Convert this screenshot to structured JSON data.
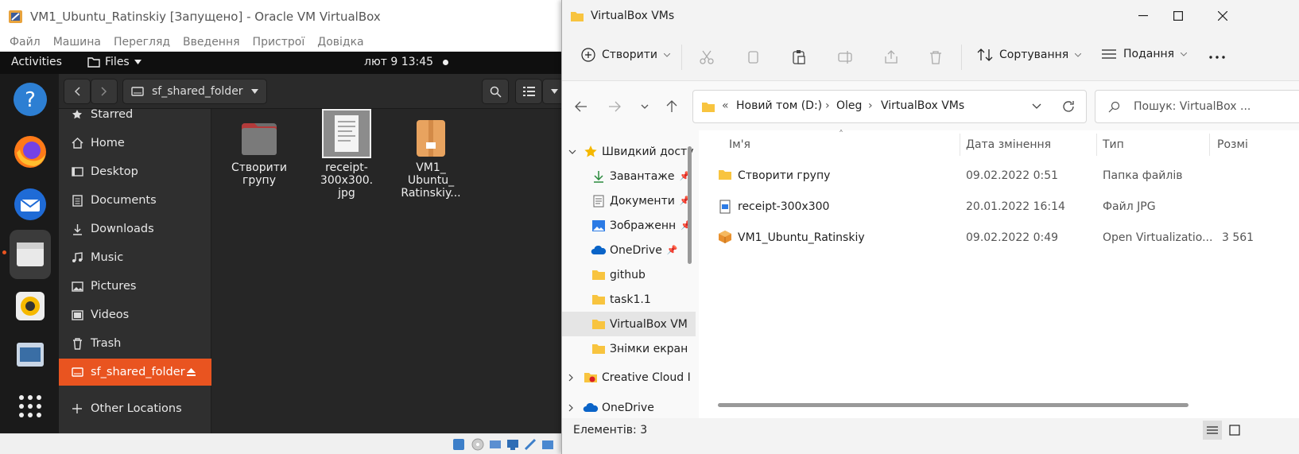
{
  "vbox": {
    "title": "VM1_Ubuntu_Ratinskiy [Запущено] - Oracle VM VirtualBox",
    "menu": [
      "Файл",
      "Машина",
      "Перегляд",
      "Введення",
      "Пристрої",
      "Довідка"
    ]
  },
  "ubuntu": {
    "activities": "Activities",
    "app_menu": "Files",
    "clock": "лют 9  13:45",
    "dock": [
      "help-icon",
      "firefox-icon",
      "thunderbird-icon",
      "files-icon",
      "rhythmbox-icon",
      "software-center-icon",
      "show-apps-icon"
    ],
    "path_label": "sf_shared_folder",
    "sidebar": [
      {
        "label": "Starred",
        "icon": "star-icon"
      },
      {
        "label": "Home",
        "icon": "home-icon"
      },
      {
        "label": "Desktop",
        "icon": "desktop-icon"
      },
      {
        "label": "Documents",
        "icon": "documents-icon"
      },
      {
        "label": "Downloads",
        "icon": "downloads-icon"
      },
      {
        "label": "Music",
        "icon": "music-icon"
      },
      {
        "label": "Pictures",
        "icon": "pictures-icon"
      },
      {
        "label": "Videos",
        "icon": "videos-icon"
      },
      {
        "label": "Trash",
        "icon": "trash-icon"
      },
      {
        "label": "sf_shared_folder",
        "icon": "drive-icon"
      },
      {
        "label": "Other Locations",
        "icon": "plus-icon"
      }
    ],
    "files": [
      {
        "l1": "Створити",
        "l2": "групу",
        "l3": ""
      },
      {
        "l1": "receipt-",
        "l2": "300x300.",
        "l3": "jpg"
      },
      {
        "l1": "VM1_",
        "l2": "Ubuntu_",
        "l3": "Ratinskiy..."
      }
    ]
  },
  "explorer": {
    "title": "VirtualBox VMs",
    "toolbar": {
      "create": "Створити",
      "sort": "Сортування",
      "view": "Подання"
    },
    "breadcrumb": [
      "Новий том (D:)",
      "Oleg",
      "VirtualBox VMs"
    ],
    "breadcrumb_prefix": "«",
    "search_placeholder": "Пошук: VirtualBox ...",
    "tree": [
      {
        "label": "Швидкий досту",
        "icon": "star-icon"
      },
      {
        "label": "Завантаже",
        "icon": "download-icon"
      },
      {
        "label": "Документи",
        "icon": "document-icon"
      },
      {
        "label": "Зображенн",
        "icon": "pictures-icon"
      },
      {
        "label": "OneDrive",
        "icon": "onedrive-icon"
      },
      {
        "label": "github",
        "icon": "folder-icon"
      },
      {
        "label": "task1.1",
        "icon": "folder-icon"
      },
      {
        "label": "VirtualBox VM",
        "icon": "folder-icon"
      },
      {
        "label": "Знімки екран",
        "icon": "folder-icon"
      },
      {
        "label": "Creative Cloud I",
        "icon": "creative-cloud-icon"
      },
      {
        "label": "OneDrive",
        "icon": "onedrive-icon"
      }
    ],
    "columns": {
      "name": "Ім'я",
      "date": "Дата змінення",
      "type": "Тип",
      "size": "Розмі"
    },
    "rows": [
      {
        "name": "Створити групу",
        "date": "09.02.2022 0:51",
        "type": "Папка файлів",
        "size": "",
        "icon": "folder-icon"
      },
      {
        "name": "receipt-300x300",
        "date": "20.01.2022 16:14",
        "type": "Файл JPG",
        "size": "",
        "icon": "image-file-icon"
      },
      {
        "name": "VM1_Ubuntu_Ratinskiy",
        "date": "09.02.2022 0:49",
        "type": "Open Virtualizatio...",
        "size": "3 561",
        "icon": "ova-file-icon"
      }
    ],
    "status": "Елементів: 3",
    "colors": {
      "folder": "#f8c43f",
      "accent": "#0067c0",
      "ubuntu_orange": "#e95420"
    }
  }
}
